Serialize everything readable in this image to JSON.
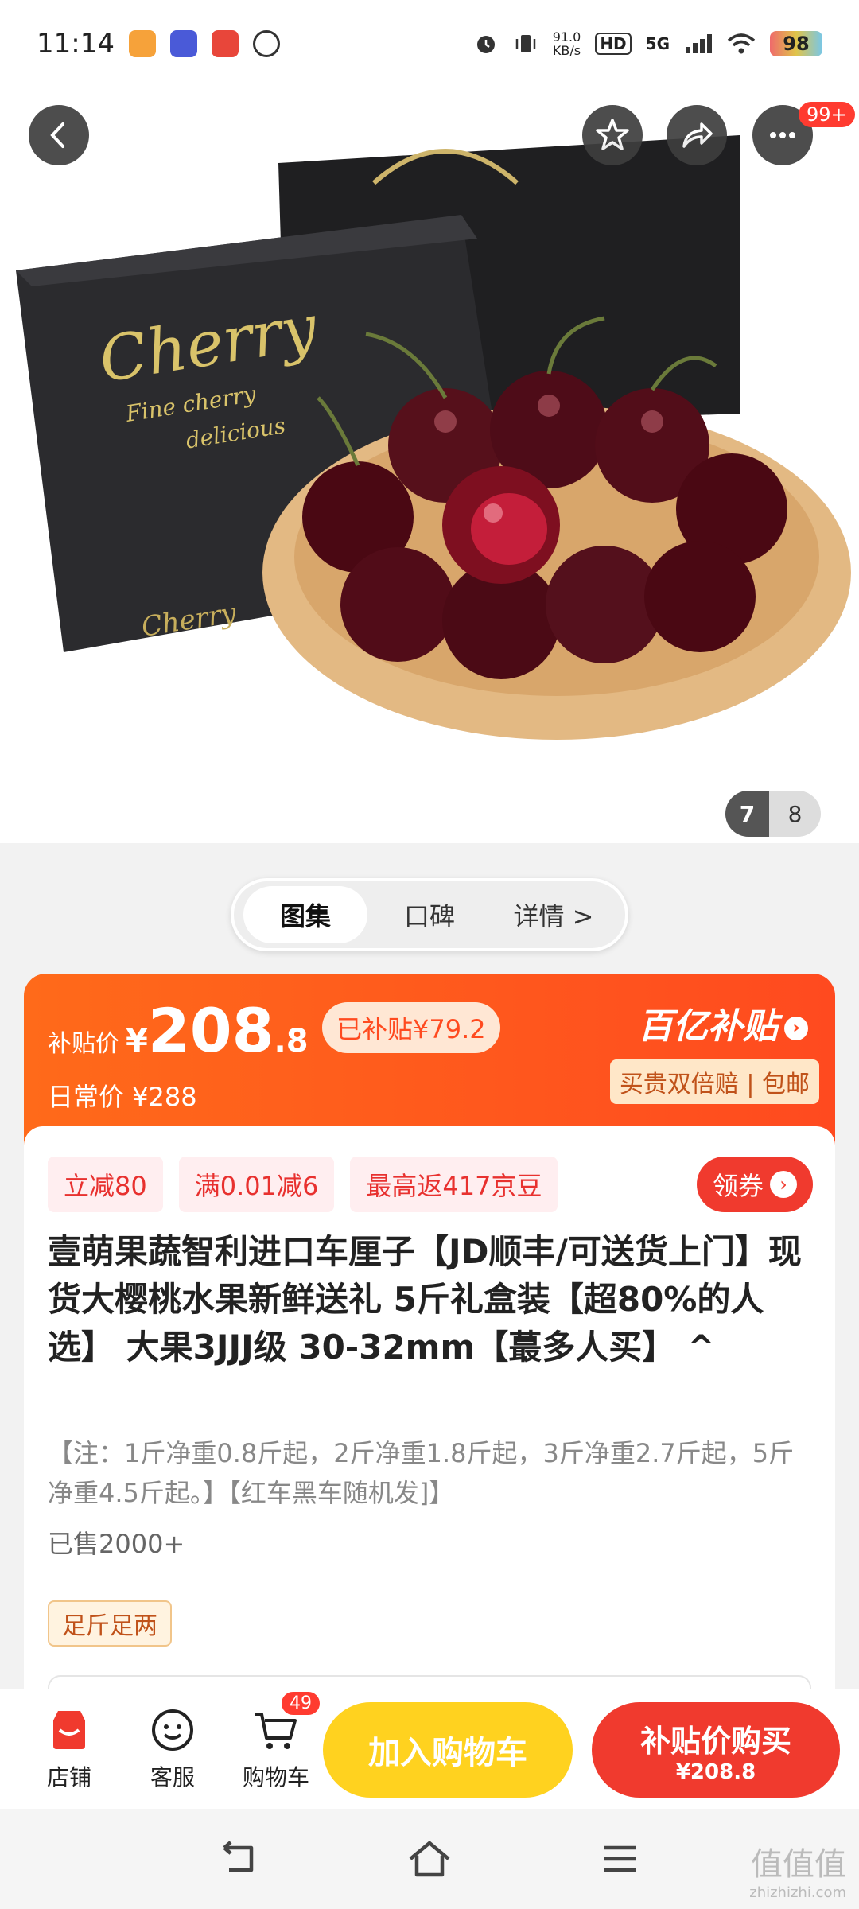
{
  "status_bar": {
    "time": "11:14",
    "net_speed_value": "91.0",
    "net_speed_unit": "KB/s",
    "hd": "HD",
    "signal": "5G",
    "battery": "98"
  },
  "hero": {
    "badge": "99+",
    "counter_current": "7",
    "counter_total": "8",
    "box_text_main": "Cherry",
    "box_text_sub1": "Fine cherry",
    "box_text_sub2": "delicious",
    "box_text_bottom": "Cherry"
  },
  "tabs": [
    {
      "label": "图集"
    },
    {
      "label": "口碑"
    },
    {
      "label": "详情 >"
    }
  ],
  "subsidy": {
    "label": "补贴价",
    "yen": "¥",
    "price_int": "208",
    "price_dec": ".8",
    "saved": "已补贴¥79.2",
    "regular": "日常价 ¥288",
    "brand": "百亿补贴",
    "brand_arrow": "›",
    "promise": "买贵双倍赔 | 包邮"
  },
  "coupons": [
    {
      "label": "立减80"
    },
    {
      "label": "满0.01减6"
    },
    {
      "label": "最高返417京豆"
    }
  ],
  "get_coupon": "领券",
  "product": {
    "title": "壹萌果蔬智利进口车厘子【JD顺丰/可送货上门】现货大樱桃水果新鲜送礼 5斤礼盒装【超80%的人选】 大果3JJJ级 30-32mm【蕞多人买】 ^",
    "note": "【注：1斤净重0.8斤起，2斤净重1.8斤起，3斤净重2.7斤起，5斤净重4.5斤起。】【红车黑车随机发]】",
    "sold": "已售2000+",
    "tag": "足斤足两"
  },
  "bottom_bar": {
    "shop": "店铺",
    "service": "客服",
    "cart": "购物车",
    "cart_count": "49",
    "add_to_cart": "加入购物车",
    "buy_title": "补贴价购买",
    "buy_price": "¥208.8"
  },
  "watermark": {
    "main": "值值值",
    "sub": "zhizhizhi.com"
  }
}
